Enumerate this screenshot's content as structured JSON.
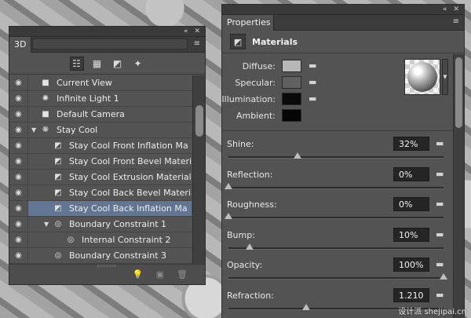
{
  "panel3d": {
    "tab_label": "3D",
    "collapse_icon": "«",
    "close_icon": "✕",
    "menu_icon": "≡",
    "toolbar": [
      {
        "name": "scene-filter-icon",
        "glyph": "☷",
        "active": true
      },
      {
        "name": "mesh-filter-icon",
        "glyph": "▦",
        "active": false
      },
      {
        "name": "material-filter-icon",
        "glyph": "◩",
        "active": false
      },
      {
        "name": "light-filter-icon",
        "glyph": "✦",
        "active": false
      }
    ],
    "items": [
      {
        "label": "Current View",
        "icon": "camera-icon",
        "glyph": "■",
        "indent": 0,
        "twisty": "",
        "selected": false
      },
      {
        "label": "Infinite Light 1",
        "icon": "infinite-light-icon",
        "glyph": "✺",
        "indent": 0,
        "twisty": "",
        "selected": false
      },
      {
        "label": "Default Camera",
        "icon": "camera-icon",
        "glyph": "■",
        "indent": 0,
        "twisty": "",
        "selected": false
      },
      {
        "label": "Stay  Cool",
        "icon": "mesh-icon",
        "glyph": "❋",
        "indent": 0,
        "twisty": "▼",
        "selected": false
      },
      {
        "label": "Stay  Cool Front Inflation Ma",
        "icon": "material-icon",
        "glyph": "◩",
        "indent": 1,
        "twisty": "",
        "selected": false
      },
      {
        "label": "Stay  Cool Front Bevel Material",
        "icon": "material-icon",
        "glyph": "◩",
        "indent": 1,
        "twisty": "",
        "selected": false
      },
      {
        "label": "Stay  Cool Extrusion Material",
        "icon": "material-icon",
        "glyph": "◩",
        "indent": 1,
        "twisty": "",
        "selected": false
      },
      {
        "label": "Stay  Cool Back Bevel Material",
        "icon": "material-icon",
        "glyph": "◩",
        "indent": 1,
        "twisty": "",
        "selected": false
      },
      {
        "label": "Stay  Cool Back Inflation Ma",
        "icon": "material-icon",
        "glyph": "◩",
        "indent": 1,
        "twisty": "",
        "selected": true
      },
      {
        "label": "Boundary Constraint 1",
        "icon": "constraint-icon",
        "glyph": "◎",
        "indent": 1,
        "twisty": "▼",
        "selected": false
      },
      {
        "label": "Internal Constraint 2",
        "icon": "constraint-icon",
        "glyph": "◎",
        "indent": 2,
        "twisty": "",
        "selected": false
      },
      {
        "label": "Boundary Constraint 3",
        "icon": "constraint-icon",
        "glyph": "◎",
        "indent": 1,
        "twisty": "",
        "selected": false
      }
    ],
    "bottom_buttons": [
      {
        "name": "add-light-icon",
        "glyph": "💡"
      },
      {
        "name": "new-scene-icon",
        "glyph": "▣"
      },
      {
        "name": "delete-icon",
        "glyph": "🗑"
      }
    ]
  },
  "props": {
    "tab_label": "Properties",
    "collapse_icon": "«",
    "close_icon": "✕",
    "menu_icon": "≡",
    "header_title": "Materials",
    "header_icon": "◩",
    "folder_glyph": "▬",
    "swatches": [
      {
        "label": "Diffuse:",
        "color": "#b7b7b7",
        "has_folder": true
      },
      {
        "label": "Specular:",
        "color": "#616161",
        "has_folder": true
      },
      {
        "label": "Illumination:",
        "color": "#0a0a0a",
        "has_folder": true
      },
      {
        "label": "Ambient:",
        "color": "#050505",
        "has_folder": false
      }
    ],
    "sliders": [
      {
        "label": "Shine:",
        "value": "32%",
        "level": 0.32
      },
      {
        "label": "Reflection:",
        "value": "0%",
        "level": 0
      },
      {
        "label": "Roughness:",
        "value": "0%",
        "level": 0
      },
      {
        "label": "Bump:",
        "value": "10%",
        "level": 0.1
      },
      {
        "label": "Opacity:",
        "value": "100%",
        "level": 1
      },
      {
        "label": "Refraction:",
        "value": "1.210",
        "level": 0.36
      }
    ],
    "sphere_arrow": "▼"
  },
  "watermark": "设计派 shejipai.cn"
}
